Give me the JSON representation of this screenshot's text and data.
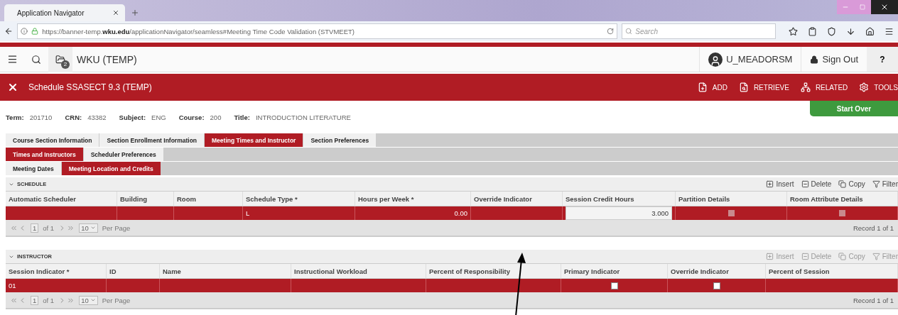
{
  "browser": {
    "tab_title": "Application Navigator",
    "url": "https://banner-temp.**wku.edu**/applicationNavigator/seamless#Meeting Time Code Validation (STVMEET)",
    "search_placeholder": "Search"
  },
  "app_header": {
    "title": "WKU (TEMP)",
    "badge": "2",
    "user": "U_MEADORSM",
    "sign_out": "Sign Out",
    "help": "?"
  },
  "page_bar": {
    "title": "Schedule SSASECT 9.3 (TEMP)",
    "actions": [
      {
        "kind": "add",
        "label": "ADD"
      },
      {
        "kind": "retrieve",
        "label": "RETRIEVE"
      },
      {
        "kind": "related",
        "label": "RELATED"
      },
      {
        "kind": "tools",
        "label": "TOOLS"
      }
    ]
  },
  "key_block": {
    "fields": [
      {
        "label": "Term:",
        "value": "201710"
      },
      {
        "label": "CRN:",
        "value": "43382"
      },
      {
        "label": "Subject:",
        "value": "ENG"
      },
      {
        "label": "Course:",
        "value": "200"
      },
      {
        "label": "Title:",
        "value": "INTRODUCTION LITERATURE"
      }
    ],
    "start_over": "Start Over"
  },
  "tabs": [
    {
      "label": "Course Section Information",
      "selected": false
    },
    {
      "label": "Section Enrollment Information",
      "selected": false
    },
    {
      "label": "Meeting Times and Instructor",
      "selected": true
    },
    {
      "label": "Section Preferences",
      "selected": false
    }
  ],
  "subtabs": [
    {
      "label": "Times and Instructors",
      "selected": true
    },
    {
      "label": "Scheduler Preferences",
      "selected": false
    }
  ],
  "subsubtabs": [
    {
      "label": "Meeting Dates",
      "selected": false
    },
    {
      "label": "Meeting Location and Credits",
      "selected": true
    }
  ],
  "sections": [
    {
      "title": "SCHEDULE",
      "tools": [
        {
          "kind": "insert",
          "label": "Insert",
          "disabled": false
        },
        {
          "kind": "delete",
          "label": "Delete",
          "disabled": false
        },
        {
          "kind": "copy",
          "label": "Copy",
          "disabled": false
        },
        {
          "kind": "filter",
          "label": "Filter",
          "disabled": false
        }
      ],
      "columns": [
        "Automatic Scheduler",
        "Building",
        "Room",
        "Schedule Type *",
        "Hours per Week *",
        "Override Indicator",
        "Session Credit Hours",
        "Partition Details",
        "Room Attribute Details"
      ],
      "rows": [
        {
          "cells": [
            {
              "kind": "empty"
            },
            {
              "kind": "empty"
            },
            {
              "kind": "empty"
            },
            {
              "kind": "text",
              "value": "L"
            },
            {
              "kind": "number",
              "value": "0.00"
            },
            {
              "kind": "empty"
            },
            {
              "kind": "input",
              "value": "3.000"
            },
            {
              "kind": "marker"
            },
            {
              "kind": "marker"
            }
          ]
        }
      ],
      "pager": {
        "page": "1",
        "of": "of 1",
        "per_page": "10",
        "per_page_label": "Per Page",
        "record": "Record 1 of 1"
      }
    },
    {
      "title": "INSTRUCTOR",
      "tools": [
        {
          "kind": "insert",
          "label": "Insert",
          "disabled": true
        },
        {
          "kind": "delete",
          "label": "Delete",
          "disabled": true
        },
        {
          "kind": "copy",
          "label": "Copy",
          "disabled": true
        },
        {
          "kind": "filter",
          "label": "Filter",
          "disabled": true
        }
      ],
      "columns": [
        "Session Indicator *",
        "ID",
        "Name",
        "Instructional Workload",
        "Percent of Responsibility",
        "Primary Indicator",
        "Override Indicator",
        "Percent of Session"
      ],
      "rows": [
        {
          "cells": [
            {
              "kind": "text",
              "value": "01"
            },
            {
              "kind": "empty"
            },
            {
              "kind": "empty"
            },
            {
              "kind": "empty"
            },
            {
              "kind": "empty"
            },
            {
              "kind": "checkbox",
              "checked": false
            },
            {
              "kind": "checkbox",
              "checked": false
            },
            {
              "kind": "empty"
            }
          ]
        }
      ],
      "pager": {
        "page": "1",
        "of": "of 1",
        "per_page": "10",
        "per_page_label": "Per Page",
        "record": "Record 1 of 1"
      }
    }
  ]
}
